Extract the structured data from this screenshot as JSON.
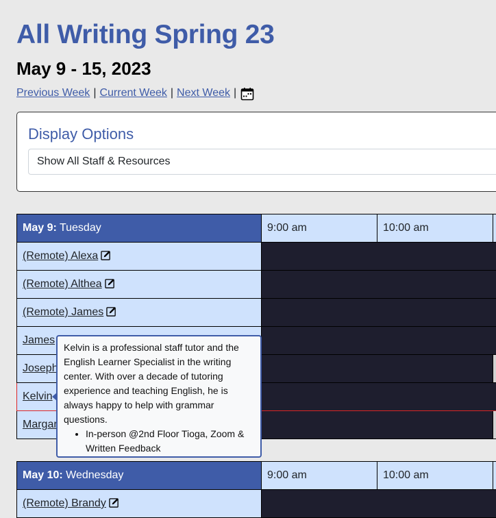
{
  "header": {
    "title": "All Writing Spring 23",
    "date_range": "May 9 - 15, 2023"
  },
  "week_nav": {
    "previous": "Previous Week",
    "current": "Current Week",
    "next": "Next Week",
    "separator": "|",
    "calendar_icon": "calendar-icon"
  },
  "display_options": {
    "title": "Display Options",
    "selected": "Show All Staff & Resources"
  },
  "colors": {
    "accent": "#3f5ca8",
    "header_light": "#cfe2fd",
    "unavailable": "#1e1e2e",
    "available": "#d3d3d3",
    "highlight": "#dc2626"
  },
  "days": [
    {
      "date": "May 9:",
      "weekday": "Tuesday",
      "times": [
        "9:00 am",
        "10:00 am"
      ],
      "staff": [
        {
          "name": "(Remote) Alexa",
          "edit": true,
          "slots": [
            "unavailable",
            "unavailable"
          ]
        },
        {
          "name": "(Remote) Althea",
          "edit": true,
          "slots": [
            "unavailable",
            "unavailable"
          ]
        },
        {
          "name": "(Remote) James",
          "edit": true,
          "slots": [
            "unavailable",
            "unavailable"
          ]
        },
        {
          "name": "James",
          "edit": false,
          "slots": [
            "unavailable",
            "unavailable"
          ]
        },
        {
          "name": "Joseph",
          "edit": false,
          "slots": [
            "unavailable",
            "unavailable-half-free"
          ]
        },
        {
          "name": "Kelvin",
          "edit": false,
          "slots": [
            "unavailable",
            "unavailable"
          ],
          "highlighted": true
        },
        {
          "name": "Margar",
          "edit": false,
          "slots": [
            "unavailable",
            "unavailable-half-free"
          ]
        }
      ]
    },
    {
      "date": "May 10:",
      "weekday": "Wednesday",
      "times": [
        "9:00 am",
        "10:00 am"
      ],
      "staff": [
        {
          "name": "(Remote) Brandy",
          "edit": true,
          "slots": [
            "unavailable",
            "unavailable"
          ]
        }
      ]
    }
  ],
  "tooltip": {
    "text": "Kelvin is a professional staff tutor and the English Learner Specialist in the writing center. With over a decade of tutoring experience and teaching English, he is always happy to help with grammar questions.",
    "bullets": [
      "In-person @2nd Floor Tioga, Zoom & Written Feedback"
    ]
  }
}
